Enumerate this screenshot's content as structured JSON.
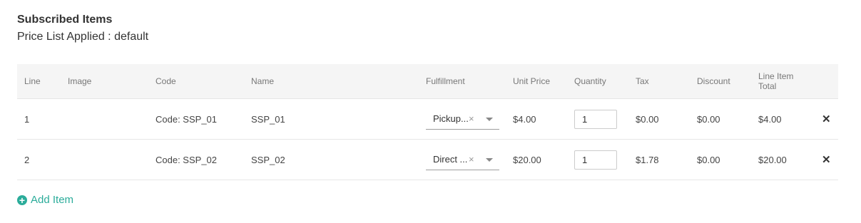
{
  "section": {
    "title": "Subscribed Items",
    "price_list_label": "Price List Applied : default"
  },
  "table": {
    "headers": {
      "line": "Line",
      "image": "Image",
      "code": "Code",
      "name": "Name",
      "fulfillment": "Fulfillment",
      "unit_price": "Unit Price",
      "quantity": "Quantity",
      "tax": "Tax",
      "discount": "Discount",
      "line_item_total": "Line Item Total"
    },
    "rows": [
      {
        "line": "1",
        "code": "Code: SSP_01",
        "name": "SSP_01",
        "fulfillment": "Pickup...",
        "unit_price": "$4.00",
        "quantity": "1",
        "tax": "$0.00",
        "discount": "$0.00",
        "total": "$4.00"
      },
      {
        "line": "2",
        "code": "Code: SSP_02",
        "name": "SSP_02",
        "fulfillment": "Direct ...",
        "unit_price": "$20.00",
        "quantity": "1",
        "tax": "$1.78",
        "discount": "$0.00",
        "total": "$20.00"
      }
    ],
    "remove_glyph": "✕",
    "clear_glyph": "×"
  },
  "add_item": {
    "label": "Add Item",
    "icon": "plus-circle-icon",
    "icon_glyph": "+"
  },
  "colors": {
    "accent": "#2bac9a",
    "header_bg": "#f5f5f5",
    "border": "#e6e6e6"
  }
}
